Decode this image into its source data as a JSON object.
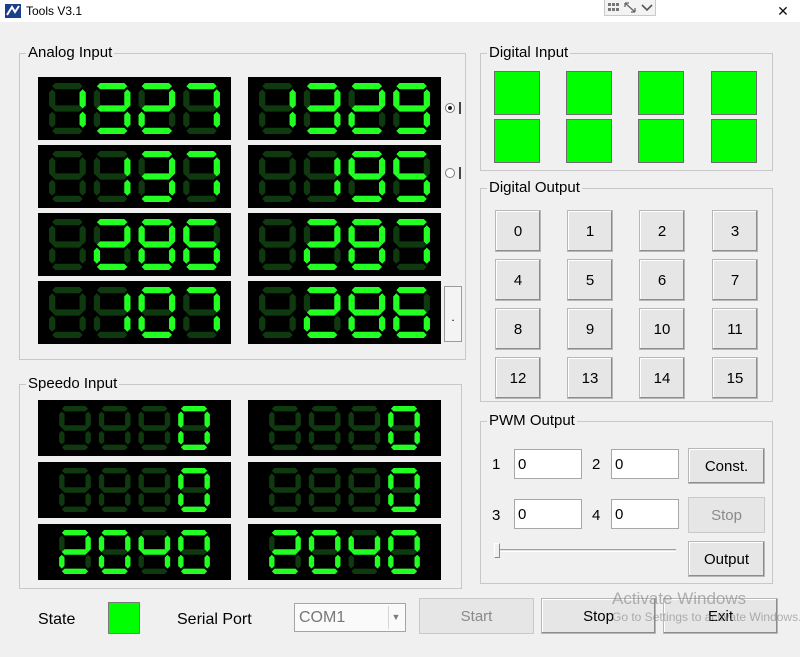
{
  "window": {
    "title": "Tools V3.1",
    "close_glyph": "✕"
  },
  "analog": {
    "label": "Analog Input",
    "values": [
      "1327",
      "1329",
      "137",
      "195",
      "286",
      "287",
      "107",
      "286"
    ],
    "radio_1_checked": true,
    "radio_2_checked": false,
    "side_button_label": "."
  },
  "speedo": {
    "label": "Speedo Input",
    "values": [
      "0",
      "0",
      "0",
      "0",
      "2040",
      "2040"
    ]
  },
  "digital_input": {
    "label": "Digital Input",
    "states": [
      true,
      true,
      true,
      true,
      true,
      true,
      true,
      true
    ]
  },
  "digital_output": {
    "label": "Digital Output",
    "buttons": [
      "0",
      "1",
      "2",
      "3",
      "4",
      "5",
      "6",
      "7",
      "8",
      "9",
      "10",
      "11",
      "12",
      "13",
      "14",
      "15"
    ]
  },
  "pwm": {
    "label": "PWM Output",
    "channels": [
      {
        "label": "1",
        "value": "0"
      },
      {
        "label": "2",
        "value": "0"
      },
      {
        "label": "3",
        "value": "0"
      },
      {
        "label": "4",
        "value": "0"
      }
    ],
    "const_label": "Const.",
    "stop_label": "Stop",
    "output_label": "Output",
    "slider_value": 0
  },
  "bottom": {
    "state_label": "State",
    "serial_port_label": "Serial Port",
    "serial_port_value": "COM1",
    "start_label": "Start",
    "stop_label": "Stop",
    "exit_label": "Exit"
  },
  "watermark": {
    "title": "Activate Windows",
    "subtitle": "Go to Settings to activate Windows."
  },
  "colors": {
    "lcd_on": "#22ff22",
    "lcd_off": "#0f3a0f",
    "lcd_bg": "#000000",
    "indicator": "#00ff00"
  }
}
